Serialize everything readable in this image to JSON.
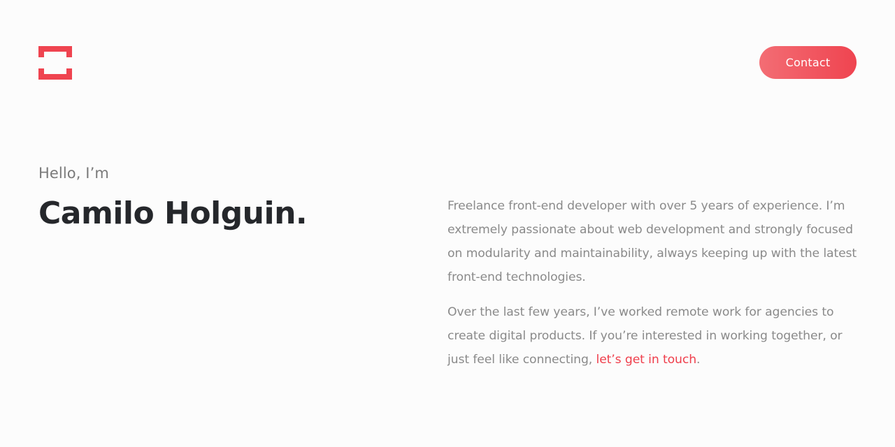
{
  "header": {
    "logo_icon": "square-bracket-logo-icon",
    "contact_label": "Contact"
  },
  "hero": {
    "greeting": "Hello, I’m",
    "name": "Camilo Holguin."
  },
  "about": {
    "paragraph_1": "Freelance front-end developer with over 5 years of experience. I’m extremely passionate about web development and strongly focused on modularity and maintainability, always keeping up with the latest front-end technologies.",
    "paragraph_2_text": "Over the last few years, I’ve worked remote work for agencies to create digital products. If you’re interested in working together, or just feel like connecting, ",
    "paragraph_2_link": "let’s get in touch",
    "paragraph_2_end": "."
  },
  "colors": {
    "accent": "#ef4450",
    "accent_light": "#f36d74",
    "heading": "#25272b",
    "body_text": "#8a8a8a",
    "background": "#fcfcfc"
  }
}
